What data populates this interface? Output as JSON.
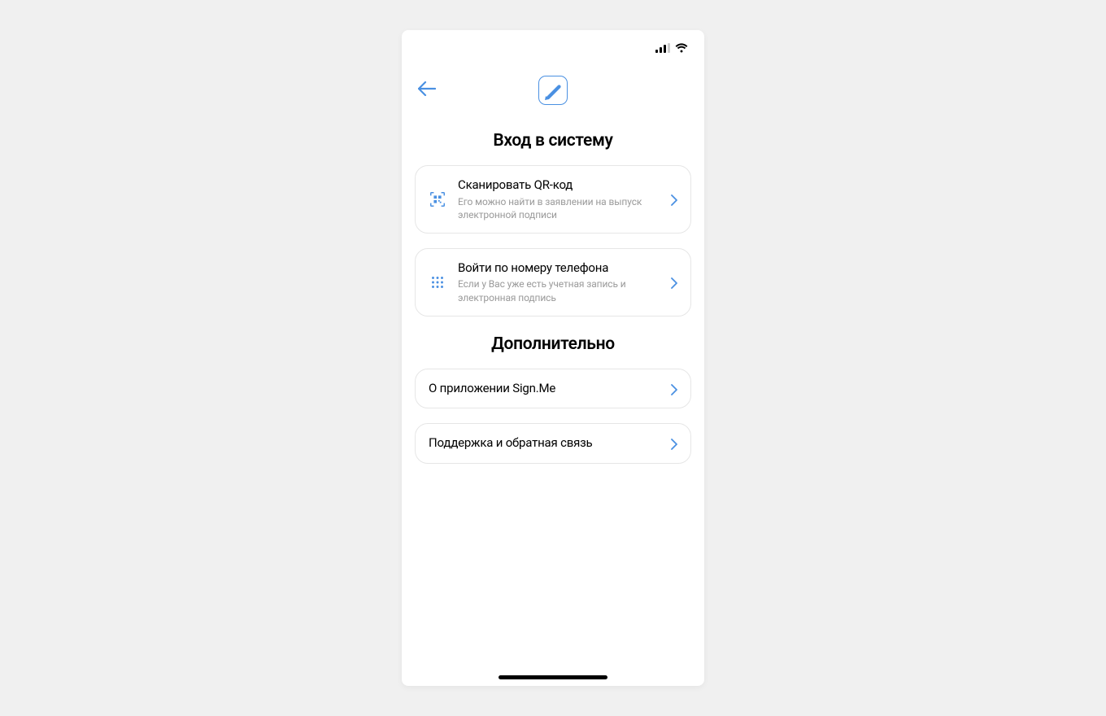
{
  "sections": {
    "login": {
      "title": "Вход в систему",
      "options": [
        {
          "title": "Сканировать QR-код",
          "subtitle": "Его можно найти в заявлении на выпуск электронной подписи"
        },
        {
          "title": "Войти по номеру телефона",
          "subtitle": "Если у Вас уже есть учетная запись и электронная подпись"
        }
      ]
    },
    "extra": {
      "title": "Дополнительно",
      "options": [
        {
          "title": "О приложении Sign.Me"
        },
        {
          "title": "Поддержка и обратная связь"
        }
      ]
    }
  },
  "colors": {
    "accent": "#4a90e2"
  }
}
